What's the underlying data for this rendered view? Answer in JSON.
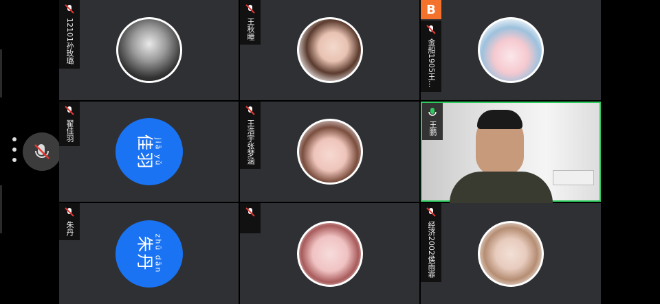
{
  "colors": {
    "tile_bg": "#2f3034",
    "avatar_blue": "#1a73f2",
    "active_border": "#2ecc5e",
    "badge_orange": "#f4722b"
  },
  "left_bar": {
    "mic_button_icon": "microphone-muted-icon",
    "menu_icon": "more-vertical-icon"
  },
  "top_badge": {
    "glyph": "B"
  },
  "tiles": [
    {
      "name_label": "12101孙玫璐",
      "avatar_kind": "photo-avatar"
    },
    {
      "name_label": "王秋瞳",
      "avatar_kind": "photo-avatar"
    },
    {
      "name_label": "金船1905王…",
      "avatar_kind": "cartoon-avatar"
    },
    {
      "name_label": "翟佳羽",
      "avatar_pinyin": "jiā yǔ",
      "avatar_text": "佳羽"
    },
    {
      "name_label": "王浩宇张梦涵",
      "avatar_kind": "photo-avatar"
    },
    {
      "name_label": "王鹏",
      "avatar_kind": "video-feed"
    },
    {
      "name_label": "朱丹",
      "avatar_pinyin": "zhū dān",
      "avatar_text": "朱丹"
    },
    {
      "name_label": "",
      "avatar_kind": "cartoon-avatar"
    },
    {
      "name_label": "经济2002侯雨霏",
      "avatar_kind": "photo-avatar"
    }
  ]
}
